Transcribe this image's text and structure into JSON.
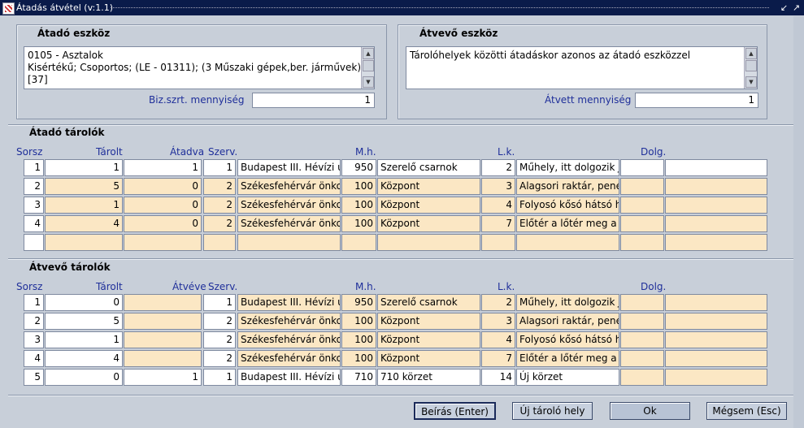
{
  "window": {
    "title": "Átadás átvétel (v:1.1)"
  },
  "source": {
    "title": "Átadó eszköz",
    "text_lines": [
      "0105 - Asztalok",
      "Kisértékű; Csoportos; (LE - 01311); (3 Műszaki gépek,ber. járművek);",
      "[37]"
    ],
    "qty_label": "Biz.szrt. mennyiség",
    "qty_value": "1"
  },
  "target": {
    "title": "Átvevő eszköz",
    "text": "Tárolóhelyek közötti átadáskor azonos az átadó eszközzel",
    "qty_label": "Átvett mennyiség",
    "qty_value": "1"
  },
  "atado_table": {
    "title": "Átadó tárolók",
    "headers": {
      "sorsz": "Sorsz",
      "tarolt": "Tárolt",
      "amount": "Átadva",
      "szerv": "Szerv.",
      "mh": "M.h.",
      "lk": "L.k.",
      "dolg": "Dolg."
    },
    "rows": [
      {
        "sorsz": "1",
        "tarolt": "1",
        "amount": "1",
        "szerv": "1",
        "addr": "Budapest III. Hévízi út",
        "mh": "950",
        "mhname": "Szerelő csarnok",
        "lk": "2",
        "lkname": "Műhely, itt dolgozik J",
        "dolg": "",
        "extra": ""
      },
      {
        "sorsz": "2",
        "tarolt": "5",
        "amount": "0",
        "szerv": "2",
        "addr": "Székesfehérvár önkor",
        "mh": "100",
        "mhname": "Központ",
        "lk": "3",
        "lkname": "Alagsori raktár, penés",
        "dolg": "",
        "extra": ""
      },
      {
        "sorsz": "3",
        "tarolt": "1",
        "amount": "0",
        "szerv": "2",
        "addr": "Székesfehérvár önkor",
        "mh": "100",
        "mhname": "Központ",
        "lk": "4",
        "lkname": "Folyosó kősó hátsó h",
        "dolg": "",
        "extra": ""
      },
      {
        "sorsz": "4",
        "tarolt": "4",
        "amount": "0",
        "szerv": "2",
        "addr": "Székesfehérvár önkor",
        "mh": "100",
        "mhname": "Központ",
        "lk": "7",
        "lkname": "Előtér a lőtér meg a l",
        "dolg": "",
        "extra": ""
      },
      {
        "sorsz": "",
        "tarolt": "",
        "amount": "",
        "szerv": "",
        "addr": "",
        "mh": "",
        "mhname": "",
        "lk": "",
        "lkname": "",
        "dolg": "",
        "extra": ""
      }
    ]
  },
  "atvevo_table": {
    "title": "Átvevő tárolók",
    "headers": {
      "sorsz": "Sorsz",
      "tarolt": "Tárolt",
      "amount": "Átvéve",
      "szerv": "Szerv.",
      "mh": "M.h.",
      "lk": "L.k.",
      "dolg": "Dolg."
    },
    "rows": [
      {
        "sorsz": "1",
        "tarolt": "0",
        "amount": "",
        "szerv": "1",
        "addr": "Budapest III. Hévízi út",
        "mh": "950",
        "mhname": "Szerelő csarnok",
        "lk": "2",
        "lkname": "Műhely, itt dolgozik J",
        "dolg": "",
        "extra": ""
      },
      {
        "sorsz": "2",
        "tarolt": "5",
        "amount": "",
        "szerv": "2",
        "addr": "Székesfehérvár önkor",
        "mh": "100",
        "mhname": "Központ",
        "lk": "3",
        "lkname": "Alagsori raktár, penés",
        "dolg": "",
        "extra": ""
      },
      {
        "sorsz": "3",
        "tarolt": "1",
        "amount": "",
        "szerv": "2",
        "addr": "Székesfehérvár önkor",
        "mh": "100",
        "mhname": "Központ",
        "lk": "4",
        "lkname": "Folyosó kősó hátsó h",
        "dolg": "",
        "extra": ""
      },
      {
        "sorsz": "4",
        "tarolt": "4",
        "amount": "",
        "szerv": "2",
        "addr": "Székesfehérvár önkor",
        "mh": "100",
        "mhname": "Központ",
        "lk": "7",
        "lkname": "Előtér a lőtér meg a l",
        "dolg": "",
        "extra": ""
      },
      {
        "sorsz": "5",
        "tarolt": "0",
        "amount": "1",
        "szerv": "1",
        "addr": "Budapest III. Hévízi út",
        "mh": "710",
        "mhname": "710 körzet",
        "lk": "14",
        "lkname": "Új körzet",
        "dolg": "",
        "extra": ""
      }
    ]
  },
  "buttons": {
    "beiras": "Beírás (Enter)",
    "uj": "Új tároló hely",
    "ok": "Ok",
    "megsem": "Mégsem (Esc)"
  },
  "colors": {
    "titlebar": "#0a1b4a",
    "label_blue": "#1f2f9a",
    "row_highlight": "#fbe7c4",
    "background": "#c8cfd9"
  },
  "icons": {
    "app": "window-app-icon",
    "minimize": "minimize-icon",
    "maximize": "maximize-icon",
    "scroll_up": "scroll-up-icon",
    "scroll_down": "scroll-down-icon"
  }
}
